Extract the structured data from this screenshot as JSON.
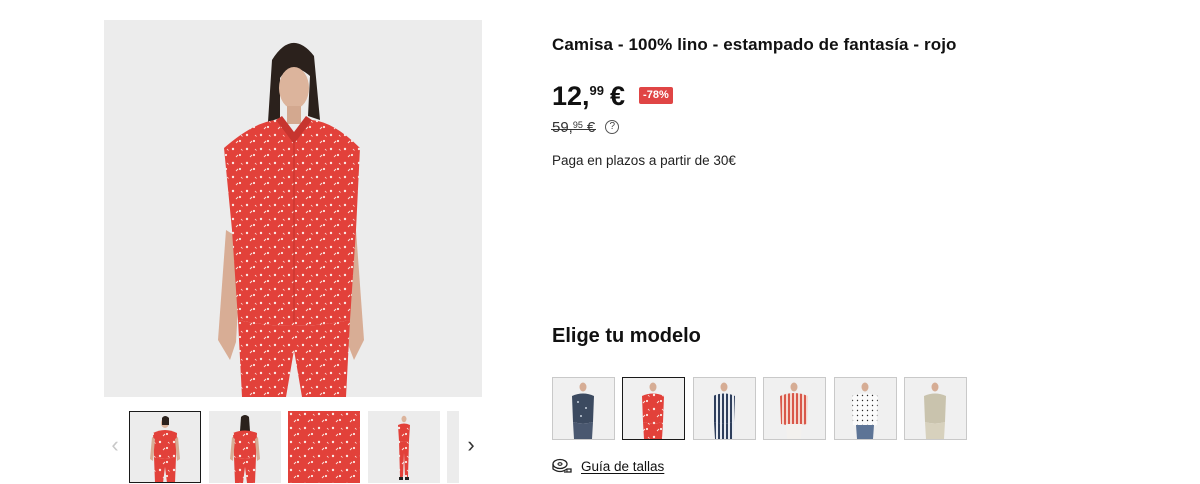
{
  "product": {
    "title": "Camisa - 100% lino - estampado de fantasía - rojo",
    "price": {
      "integer": "12,",
      "decimals": "99",
      "currency": "€"
    },
    "discount_badge": "-78%",
    "old_price": {
      "integer": "59,",
      "decimals": "95",
      "currency": "€"
    },
    "installments_text": "Paga en plazos a partir de 30€"
  },
  "gallery": {
    "prev_arrow": "‹",
    "next_arrow": "›",
    "selected_thumbnail": 1,
    "thumbnails": [
      "front-view",
      "back-view",
      "fabric-detail",
      "full-body-view",
      "partial-next"
    ]
  },
  "models": {
    "heading": "Elige tu modelo",
    "selected_index": 2,
    "variants": [
      "navy-print",
      "red-print",
      "blue-stripes",
      "red-stripes",
      "white-dots",
      "beige"
    ]
  },
  "size_guide": {
    "label": "Guía de tallas",
    "icon": "measuring-tape-icon"
  },
  "colors": {
    "accent_red": "#e04545",
    "shirt_red": "#e2413a",
    "text": "#111111",
    "image_bg": "#ececec"
  }
}
